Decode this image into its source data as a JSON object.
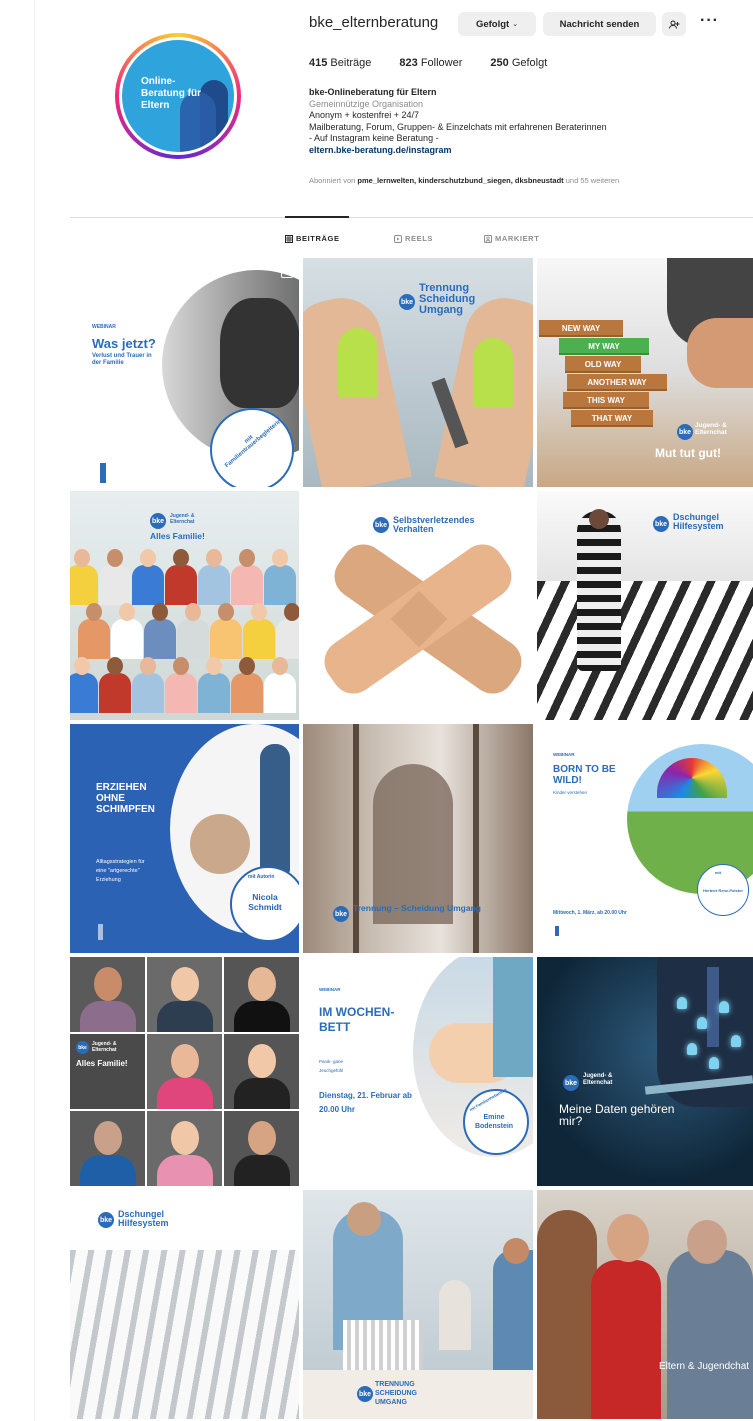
{
  "profile": {
    "username": "bke_elternberatung",
    "avatar_text": "Online-Beratung für Eltern",
    "buttons": {
      "follow": "Gefolgt",
      "message": "Nachricht senden",
      "add_user": "+²"
    },
    "stats": {
      "posts_count": "415",
      "posts_label": "Beiträge",
      "followers_count": "823",
      "followers_label": "Follower",
      "following_count": "250",
      "following_label": "Gefolgt"
    },
    "bio": {
      "name": "bke-Onlineberatung für Eltern",
      "category": "Gemeinnützige Organisation",
      "line1": "Anonym + kostenfrei + 24/7",
      "line2": "Mailberatung, Forum, Gruppen- & Einzelchats mit erfahrenen Beraterinnen",
      "line3": "- Auf Instagram keine Beratung -",
      "link": "eltern.bke-beratung.de/instagram"
    },
    "followed_by": {
      "prefix": "Abonniert von ",
      "accounts": "pme_lernwelten, kinderschutzbund_siegen, dksbneustadt",
      "suffix": " und 55 weiteren"
    }
  },
  "tabs": [
    {
      "label": "BEITRÄGE",
      "icon": "grid-icon",
      "active": true
    },
    {
      "label": "REELS",
      "icon": "reels-icon",
      "active": false
    },
    {
      "label": "MARKIERT",
      "icon": "tag-icon",
      "active": false
    }
  ],
  "posts": {
    "p1": {
      "small": "WEBINAR",
      "title": "Was jetzt?",
      "sub": "Verlust und Trauer in der Familie",
      "badge": "mit Familientrauerbegleiterin"
    },
    "p2": {
      "title": "Trennung Scheidung Umgang"
    },
    "p3": {
      "blocks": [
        "NEW WAY",
        "MY WAY",
        "OLD WAY",
        "ANOTHER WAY",
        "THIS WAY",
        "THAT WAY"
      ],
      "brand": "Jugend- & Elternchat",
      "caption": "Mut tut gut!"
    },
    "p4": {
      "brand": "Jugend- & Elternchat",
      "title": "Alles Familie!"
    },
    "p5": {
      "title": "Selbstverletzendes Verhalten"
    },
    "p6": {
      "title": "Dschungel Hilfesystem"
    },
    "p7": {
      "title": "ERZIEHEN OHNE SCHIMPFEN",
      "sub": "Alltagsstrategien für eine \"artgerechte\" Erziehung",
      "badge": "mit Autorin",
      "author": "Nicola Schmidt"
    },
    "p8": {
      "title": "Trennung – Scheidung Umgang"
    },
    "p9": {
      "small": "WEBINAR",
      "title": "BORN TO BE WILD!",
      "sub": "Kinder verstehen",
      "date": "Mittwoch, 1. März, ab 20.00 Uhr",
      "badge": "mit",
      "author": "Herbert Renz-Polster"
    },
    "p10": {
      "brand": "Jugend- & Elternchat",
      "title": "Alles Familie!"
    },
    "p11": {
      "small": "WEBINAR",
      "title": "IM WOCHEN-BETT",
      "sub": "Panik- gane Jeuchgefühl",
      "date": "Dienstag, 21. Februar ab 20.00 Uhr",
      "badge": "mit Familienhebamme",
      "author": "Emine Bodenstein"
    },
    "p12": {
      "brand": "Jugend- & Elternchat",
      "title": "Meine Daten gehören mir?"
    },
    "p13": {
      "title": "Dschungel Hilfesystem"
    },
    "p14": {
      "title": "TRENNUNG SCHEIDUNG UMGANG"
    },
    "p15": {
      "title": "Eltern & Jugendchat"
    }
  },
  "colors": {
    "accent_blue": "#2b6cb8",
    "link": "#00376b",
    "muted": "#8e8e8e"
  }
}
